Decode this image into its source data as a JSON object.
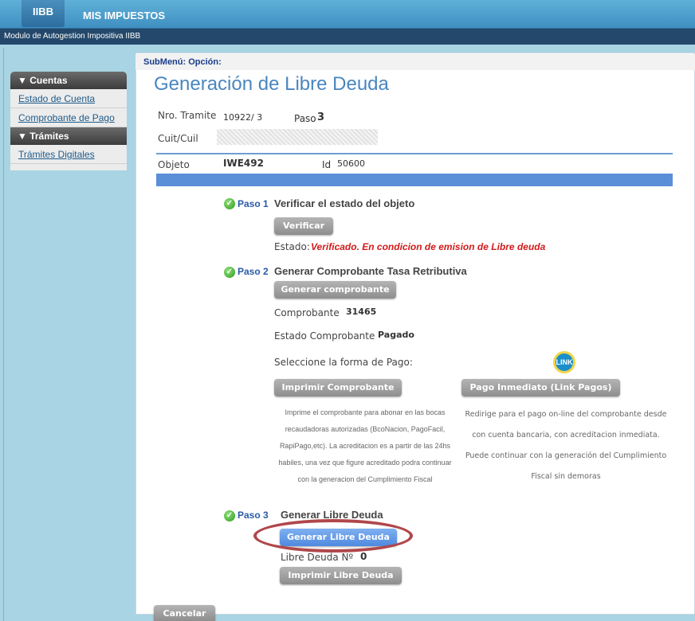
{
  "header": {
    "tab_active": "IIBB",
    "tab_other": "MIS IMPUESTOS",
    "subtitle": "Modulo de Autogestion Impositiva IIBB"
  },
  "sidebar": {
    "section1": "▼ Cuentas",
    "items1": [
      "Estado de Cuenta",
      "Comprobante de Pago"
    ],
    "section2": "▼ Trámites",
    "items2": [
      "Trámites Digitales"
    ]
  },
  "main": {
    "submenu": "SubMenú: Opción:",
    "title": "Generación de Libre Deuda",
    "nro_tramite_label": "Nro. Tramite",
    "nro_tramite_value": "10922/ 3",
    "paso_label": "Paso",
    "paso_value": "3",
    "cuit_label": "Cuit/Cuil",
    "objeto_label": "Objeto",
    "objeto_value": "IWE492",
    "id_label": "Id",
    "id_value": "50600"
  },
  "step1": {
    "label": "Paso 1",
    "title": "Verificar el estado del objeto",
    "button": "Verificar",
    "estado_label": "Estado:",
    "estado_value": "Verificado. En condicion de emision de Libre deuda"
  },
  "step2": {
    "label": "Paso 2",
    "title": "Generar Comprobante Tasa Retributiva",
    "button": "Generar comprobante",
    "comprobante_label": "Comprobante",
    "comprobante_value": "31465",
    "estado_comp_label": "Estado Comprobante",
    "estado_comp_value": "Pagado",
    "forma_pago_label": "Seleccione la forma de Pago:",
    "link_icon_text": "LINK",
    "btn_imprimir": "Imprimir Comprobante",
    "btn_pago": "Pago Inmediato (Link Pagos)",
    "desc_imprimir": [
      "Imprime el comprobante para abonar en las bocas",
      "recaudadoras autorizadas (BcoNacion, PagoFacil,",
      "RapiPago,etc). La acreditacion es a partir de las 24hs",
      "habiles, una vez que figure acreditado podra continuar",
      "con la generacion del Cumplimiento Fiscal"
    ],
    "desc_pago": [
      "Redirige para el pago on-line del comprobante desde",
      "con cuenta bancaria, con acreditacion inmediata.",
      "Puede continuar con la generación del Cumplimiento",
      "Fiscal sin demoras"
    ]
  },
  "step3": {
    "label": "Paso 3",
    "title": "Generar Libre Deuda",
    "button": "Generar Libre Deuda",
    "libre_deuda_label": "Libre Deuda Nº",
    "libre_deuda_value": "0",
    "btn_imprimir": "Imprimir Libre Deuda"
  },
  "footer": {
    "cancel": "Cancelar"
  }
}
